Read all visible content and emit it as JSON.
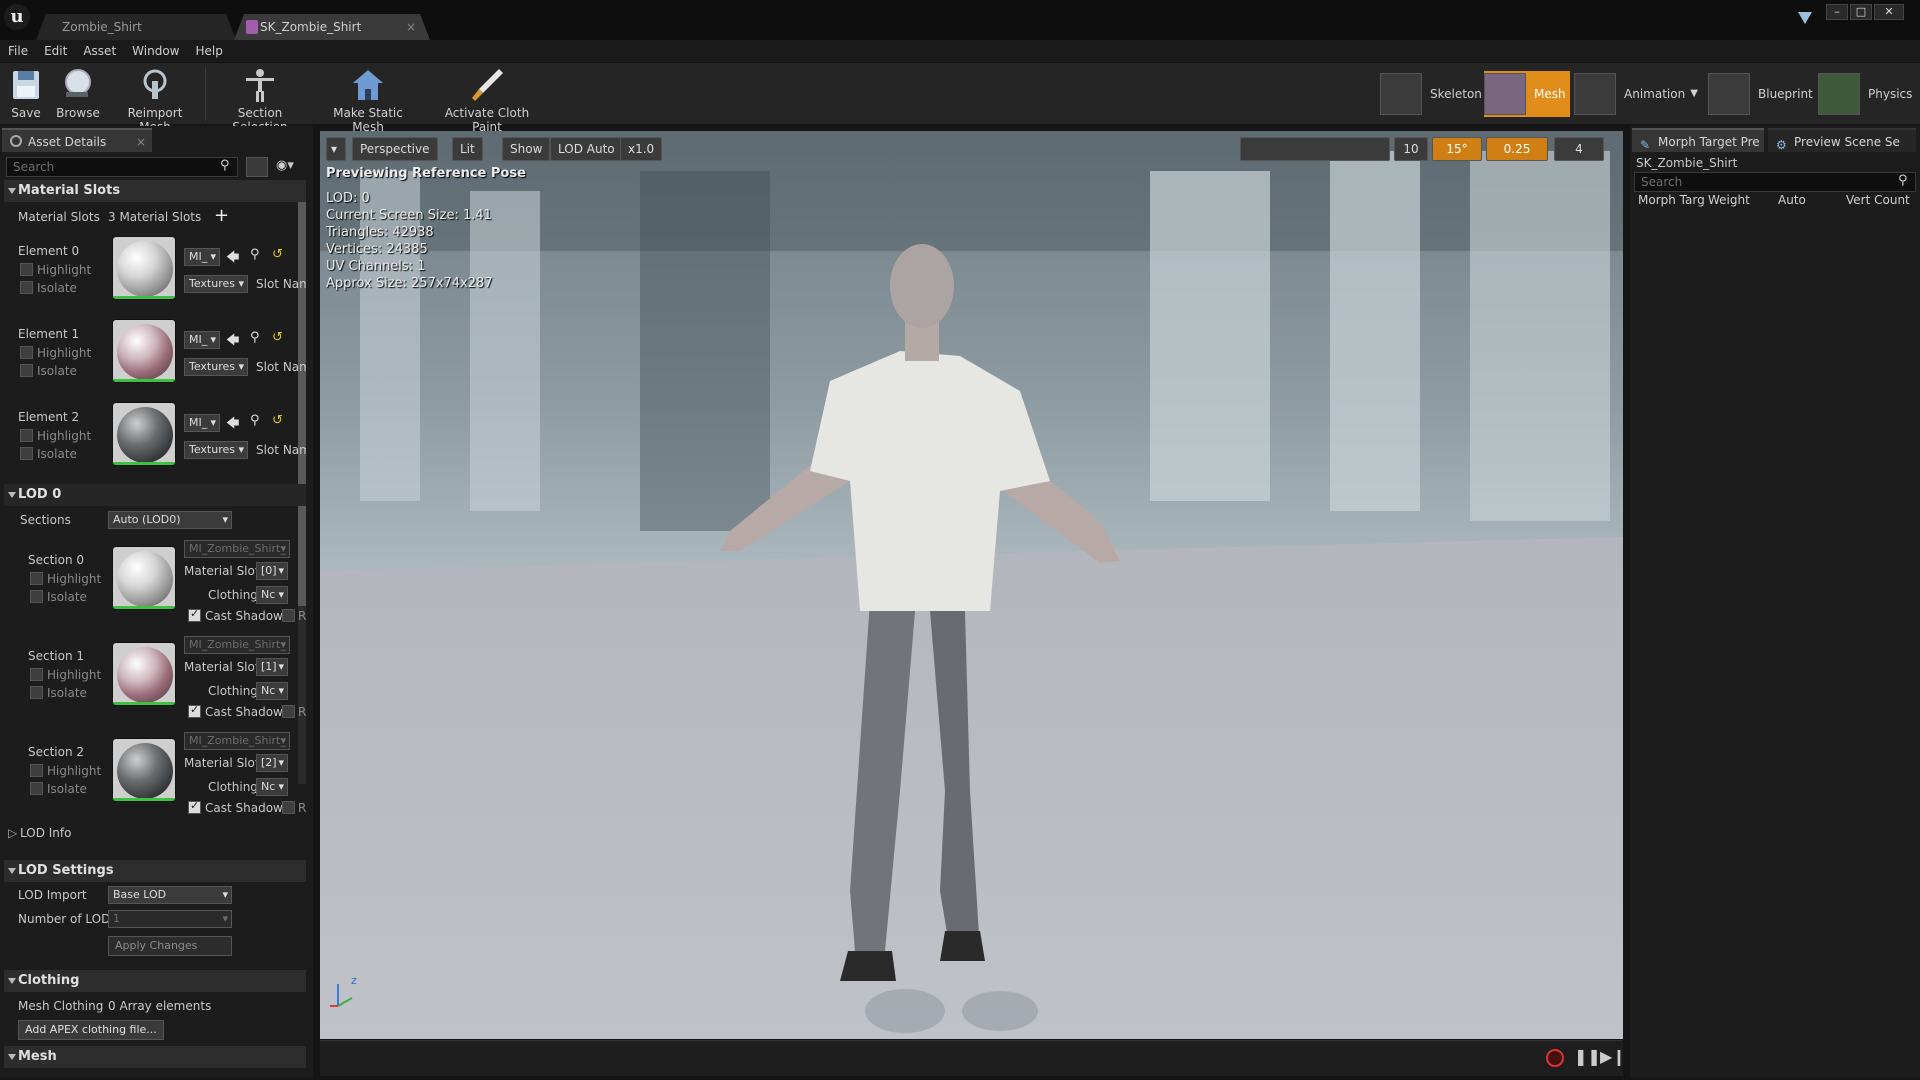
{
  "tabs": [
    {
      "label": "Zombie_Shirt"
    },
    {
      "label": "SK_Zombie_Shirt",
      "close": "×"
    }
  ],
  "window_controls": {
    "minimize": "–",
    "maximize": "□",
    "close": "✕"
  },
  "menu": [
    "File",
    "Edit",
    "Asset",
    "Window",
    "Help"
  ],
  "toolbar": {
    "buttons": [
      {
        "label": "Save",
        "icon": "save-icon"
      },
      {
        "label": "Browse",
        "icon": "magnifier-icon"
      },
      {
        "label": "Reimport Mesh",
        "icon": "reimport-icon"
      },
      {
        "label": "Section Selection",
        "icon": "skeleton-pose-icon"
      },
      {
        "label": "Make Static Mesh",
        "icon": "house-icon"
      },
      {
        "label": "Activate Cloth Paint",
        "icon": "paint-brush-icon"
      }
    ],
    "modes": [
      {
        "label": "Skeleton"
      },
      {
        "label": "Mesh"
      },
      {
        "label": "Animation"
      },
      {
        "label": "Blueprint"
      },
      {
        "label": "Physics"
      }
    ],
    "active_mode_color": "#e08d1a"
  },
  "left_panel": {
    "tab": "Asset Details",
    "search_placeholder": "Search",
    "material_slots": {
      "header": "Material Slots",
      "label": "Material Slots",
      "count": "3 Material Slots",
      "add": "+",
      "elements": [
        {
          "name": "Element 0",
          "mat": "MI_",
          "tex": "Textures",
          "slot": "Slot Name"
        },
        {
          "name": "Element 1",
          "mat": "MI_",
          "tex": "Textures",
          "slot": "Slot Name"
        },
        {
          "name": "Element 2",
          "mat": "MI_",
          "tex": "Textures",
          "slot": "Slot Name"
        }
      ],
      "highlight": "Highlight",
      "isolate": "Isolate"
    },
    "lod0": {
      "header": "LOD 0",
      "sections_label": "Sections",
      "sections_value": "Auto (LOD0)",
      "sections": [
        {
          "name": "Section 0",
          "mat": "MI_Zombie_Shirt_",
          "slot": "[0]",
          "clothing": "Nc"
        },
        {
          "name": "Section 1",
          "mat": "MI_Zombie_Shirt_",
          "slot": "[1]",
          "clothing": "Nc"
        },
        {
          "name": "Section 2",
          "mat": "MI_Zombie_Shirt_",
          "slot": "[2]",
          "clothing": "Nc"
        }
      ],
      "material_slot_label": "Material Slot",
      "clothing_label": "Clothing",
      "cast_shadows": "Cast Shadows",
      "re": "Re",
      "lod_info": "LOD Info"
    },
    "lod_settings": {
      "header": "LOD Settings",
      "lod_import_label": "LOD Import",
      "lod_import_value": "Base LOD",
      "num_lods_label": "Number of LODs",
      "num_lods_value": "1",
      "apply": "Apply Changes"
    },
    "clothing": {
      "header": "Clothing",
      "label": "Mesh Clothing A",
      "value": "0 Array elements",
      "button": "Add APEX clothing file..."
    },
    "mesh_header": "Mesh"
  },
  "viewport": {
    "buttons": {
      "menu": "▾",
      "perspective": "Perspective",
      "lit": "Lit",
      "show": "Show",
      "lod": "LOD Auto",
      "speed": "x1.0"
    },
    "right_controls": {
      "grid": "10",
      "angle": "15°",
      "scale": "0.25",
      "camera": "4"
    },
    "title": "Previewing Reference Pose",
    "stats": [
      "LOD: 0",
      "Current Screen Size: 1.41",
      "Triangles: 42938",
      "Vertices: 24385",
      "UV Channels: 1",
      "Approx Size: 257x74x287"
    ],
    "axis_z": "z"
  },
  "right_panel": {
    "tabs": [
      "Morph Target Pre",
      "Preview Scene Se"
    ],
    "asset": "SK_Zombie_Shirt",
    "search_placeholder": "Search",
    "columns": [
      "Morph Targ",
      "Weight",
      "Auto",
      "Vert Count"
    ]
  }
}
